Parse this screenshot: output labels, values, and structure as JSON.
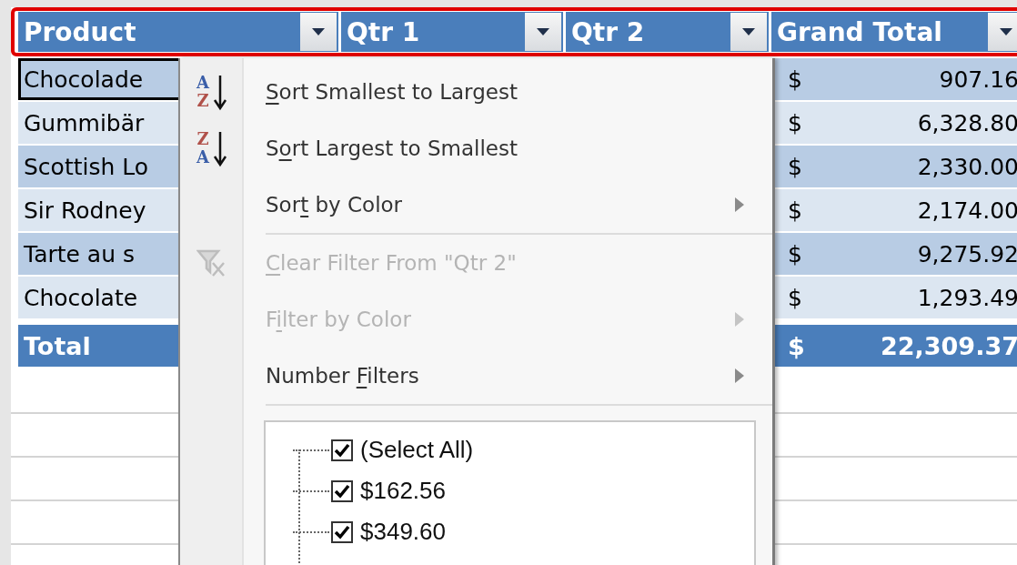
{
  "table": {
    "columns": [
      {
        "label": "Product"
      },
      {
        "label": "Qtr 1"
      },
      {
        "label": "Qtr 2"
      },
      {
        "label": "Grand Total"
      }
    ],
    "rows": [
      {
        "product": "Chocolade",
        "selected": true,
        "currency": "$",
        "amount": "907.16"
      },
      {
        "product": "Gummibär",
        "selected": false,
        "currency": "$",
        "amount": "6,328.80"
      },
      {
        "product": "Scottish Lo",
        "selected": false,
        "currency": "$",
        "amount": "2,330.00"
      },
      {
        "product": "Sir Rodney",
        "selected": false,
        "currency": "$",
        "amount": "2,174.00"
      },
      {
        "product": "Tarte au s",
        "selected": false,
        "currency": "$",
        "amount": "9,275.92"
      },
      {
        "product": "Chocolate",
        "selected": false,
        "currency": "$",
        "amount": "1,293.49"
      }
    ],
    "total": {
      "label": "Total",
      "currency": "$",
      "amount": "22,309.37"
    }
  },
  "filter_menu": {
    "items": [
      {
        "kind": "sort_ascending",
        "icon_letters": [
          "A",
          "Z"
        ],
        "key": "S",
        "after": "ort Smallest to Largest",
        "disabled": false,
        "submenu": false
      },
      {
        "kind": "sort_descending",
        "icon_letters": [
          "Z",
          "A"
        ],
        "before": "S",
        "key": "o",
        "after": "rt Largest to Smallest",
        "disabled": false,
        "submenu": false
      },
      {
        "kind": "command",
        "before": "Sor",
        "key": "t",
        "after": " by Color",
        "disabled": false,
        "submenu": true
      },
      {
        "kind": "separator"
      },
      {
        "kind": "clear_filter",
        "key": "C",
        "after": "lear Filter From \"Qtr 2\"",
        "disabled": true,
        "submenu": false
      },
      {
        "kind": "command",
        "before": "F",
        "key": "i",
        "after": "lter by Color",
        "disabled": true,
        "submenu": true
      },
      {
        "kind": "command",
        "before": "Number ",
        "key": "F",
        "after": "ilters",
        "disabled": false,
        "submenu": true
      },
      {
        "kind": "separator"
      }
    ],
    "values": [
      {
        "label": "(Select All)",
        "checked": true
      },
      {
        "label": "$162.56",
        "checked": true
      },
      {
        "label": "$349.60",
        "checked": true
      }
    ]
  }
}
